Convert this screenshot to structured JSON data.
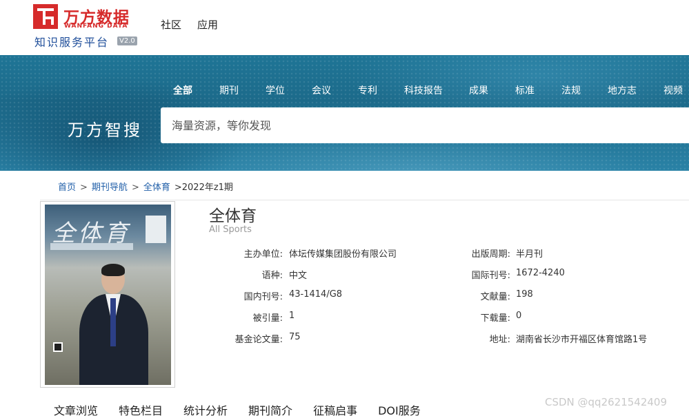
{
  "header": {
    "logo_cn": "万方数据",
    "logo_en": "WANFANG DATA",
    "logo_sub": "知识服务平台",
    "logo_version": "V2.0",
    "nav": [
      "社区",
      "应用"
    ]
  },
  "banner": {
    "categories": [
      "全部",
      "期刊",
      "学位",
      "会议",
      "专利",
      "科技报告",
      "成果",
      "标准",
      "法规",
      "地方志",
      "视频"
    ],
    "active_category": "全部",
    "brand": "万方智搜",
    "search_placeholder": "海量资源，等你发现"
  },
  "breadcrumb": {
    "items": [
      "首页",
      "期刊导航",
      "全体育"
    ],
    "current": ">2022年z1期",
    "separator": ">"
  },
  "journal": {
    "title": "全体育",
    "title_en": "All Sports",
    "cover_text": "全体育",
    "left_fields": [
      {
        "label": "主办单位:",
        "value": "体坛传媒集团股份有限公司"
      },
      {
        "label": "语种:",
        "value": "中文"
      },
      {
        "label": "国内刊号:",
        "value": "43-1414/G8"
      },
      {
        "label": "被引量:",
        "value": "1"
      },
      {
        "label": "基金论文量:",
        "value": "75"
      }
    ],
    "right_fields": [
      {
        "label": "出版周期:",
        "value": "半月刊"
      },
      {
        "label": "国际刊号:",
        "value": "1672-4240"
      },
      {
        "label": "文献量:",
        "value": "198"
      },
      {
        "label": "下载量:",
        "value": "0"
      },
      {
        "label": "地址:",
        "value": "湖南省长沙市开福区体育馆路1号"
      }
    ]
  },
  "tabs": [
    "文章浏览",
    "特色栏目",
    "统计分析",
    "期刊简介",
    "征稿启事",
    "DOI服务"
  ],
  "watermark": "CSDN @qq2621542409",
  "colors": {
    "brand_red": "#d62b2b",
    "link_blue": "#1f5ea8",
    "banner_blue": "#1f7596"
  }
}
